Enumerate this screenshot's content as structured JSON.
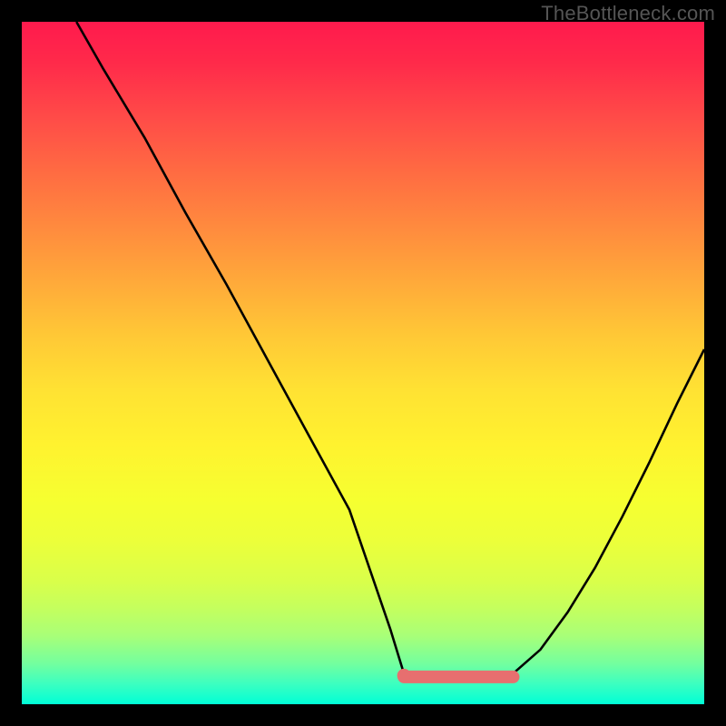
{
  "watermark": "TheBottleneck.com",
  "colors": {
    "highlight": "#e76f6f",
    "curve": "#000000"
  },
  "chart_data": {
    "type": "line",
    "title": "",
    "xlabel": "",
    "ylabel": "",
    "xlim": [
      0,
      100
    ],
    "ylim": [
      0,
      100
    ],
    "grid": false,
    "notes": "Unlabeled bottleneck curve. x is an implicit 0–100 horizontal axis (left→right), y is bottleneck severity in percent (top=100, bottom=0). Lower y is better. The curve falls from ~100 at x≈8 to ~4 over x≈56–72, then rises toward ~52 at x=100. A salmon bar marks the optimal (near-zero bottleneck) range ≈56–72.",
    "series": [
      {
        "name": "left_branch",
        "x": [
          8,
          12,
          18,
          24,
          30,
          36,
          42,
          48,
          54,
          56
        ],
        "y": [
          100,
          93,
          83,
          72,
          61.5,
          50.5,
          39.5,
          28.5,
          11,
          4.5
        ]
      },
      {
        "name": "flat_trough",
        "x": [
          56,
          60,
          64,
          68,
          72
        ],
        "y": [
          4.5,
          4.0,
          4.0,
          4.0,
          4.5
        ]
      },
      {
        "name": "right_branch",
        "x": [
          72,
          76,
          80,
          84,
          88,
          92,
          96,
          100
        ],
        "y": [
          4.5,
          8,
          13.5,
          20,
          27.5,
          35.5,
          44,
          52
        ]
      }
    ],
    "optimal_range": {
      "x_start": 56,
      "x_end": 72,
      "y": 4.0
    },
    "optimal_marker_dot": {
      "x": 56,
      "y": 4.2
    }
  }
}
